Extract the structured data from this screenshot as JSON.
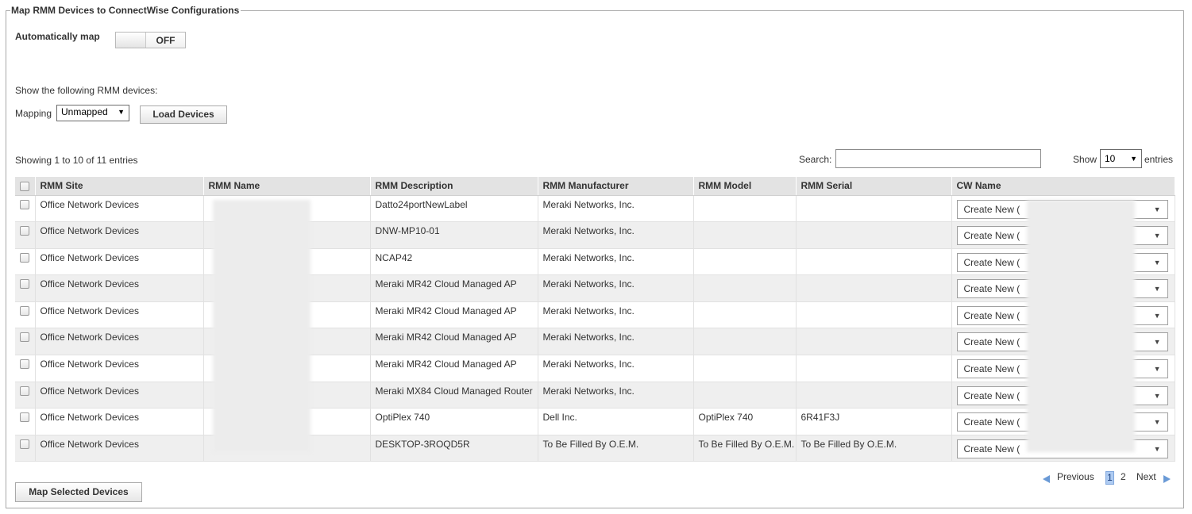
{
  "legend": "Map RMM Devices to ConnectWise Configurations",
  "auto_map": {
    "label": "Automatically map",
    "state": "OFF"
  },
  "filter": {
    "intro": "Show the following RMM devices:",
    "mapping_label": "Mapping",
    "mapping_value": "Unmapped",
    "load_button": "Load Devices"
  },
  "table_info": {
    "showing": "Showing 1 to 10 of 11 entries",
    "search_label": "Search:",
    "search_value": "",
    "show_label": "Show",
    "show_value": "10",
    "entries_label": "entries"
  },
  "columns": [
    "RMM Site",
    "RMM Name",
    "RMM Description",
    "RMM Manufacturer",
    "RMM Model",
    "RMM Serial",
    "CW Name"
  ],
  "rows": [
    {
      "site": "Office Network Devices",
      "name": "",
      "description": "Datto24portNewLabel",
      "manufacturer": "Meraki Networks, Inc.",
      "model": "",
      "serial": "",
      "cw_name": "Create New ("
    },
    {
      "site": "Office Network Devices",
      "name": "",
      "description": "DNW-MP10-01",
      "manufacturer": "Meraki Networks, Inc.",
      "model": "",
      "serial": "",
      "cw_name": "Create New ("
    },
    {
      "site": "Office Network Devices",
      "name": "",
      "description": "NCAP42",
      "manufacturer": "Meraki Networks, Inc.",
      "model": "",
      "serial": "",
      "cw_name": "Create New ("
    },
    {
      "site": "Office Network Devices",
      "name": "",
      "description": "Meraki MR42 Cloud Managed AP",
      "manufacturer": "Meraki Networks, Inc.",
      "model": "",
      "serial": "",
      "cw_name": "Create New ("
    },
    {
      "site": "Office Network Devices",
      "name": "",
      "description": "Meraki MR42 Cloud Managed AP",
      "manufacturer": "Meraki Networks, Inc.",
      "model": "",
      "serial": "",
      "cw_name": "Create New ("
    },
    {
      "site": "Office Network Devices",
      "name": "",
      "description": "Meraki MR42 Cloud Managed AP",
      "manufacturer": "Meraki Networks, Inc.",
      "model": "",
      "serial": "",
      "cw_name": "Create New ("
    },
    {
      "site": "Office Network Devices",
      "name": "",
      "description": "Meraki MR42 Cloud Managed AP",
      "manufacturer": "Meraki Networks, Inc.",
      "model": "",
      "serial": "",
      "cw_name": "Create New ("
    },
    {
      "site": "Office Network Devices",
      "name": "",
      "description": "Meraki MX84 Cloud Managed Router",
      "manufacturer": "Meraki Networks, Inc.",
      "model": "",
      "serial": "",
      "cw_name": "Create New ("
    },
    {
      "site": "Office Network Devices",
      "name": "",
      "description": "OptiPlex 740",
      "manufacturer": "Dell Inc.",
      "model": "OptiPlex 740",
      "serial": "6R41F3J",
      "cw_name": "Create New ("
    },
    {
      "site": "Office Network Devices",
      "name": "",
      "description": "DESKTOP-3ROQD5R",
      "manufacturer": "To Be Filled By O.E.M.",
      "model": "To Be Filled By O.E.M.",
      "serial": "To Be Filled By O.E.M.",
      "cw_name": "Create New ("
    }
  ],
  "pagination": {
    "previous": "Previous",
    "pages": [
      "1",
      "2"
    ],
    "current": "1",
    "next": "Next"
  },
  "map_button": "Map Selected Devices",
  "colors": {
    "accent": "#6a9ad6",
    "header_bg": "#e3e3e3",
    "row_alt": "#efefef"
  },
  "icons": {
    "dropdown": "triangle-down-icon",
    "prev": "triangle-left-icon",
    "next": "triangle-right-icon"
  }
}
